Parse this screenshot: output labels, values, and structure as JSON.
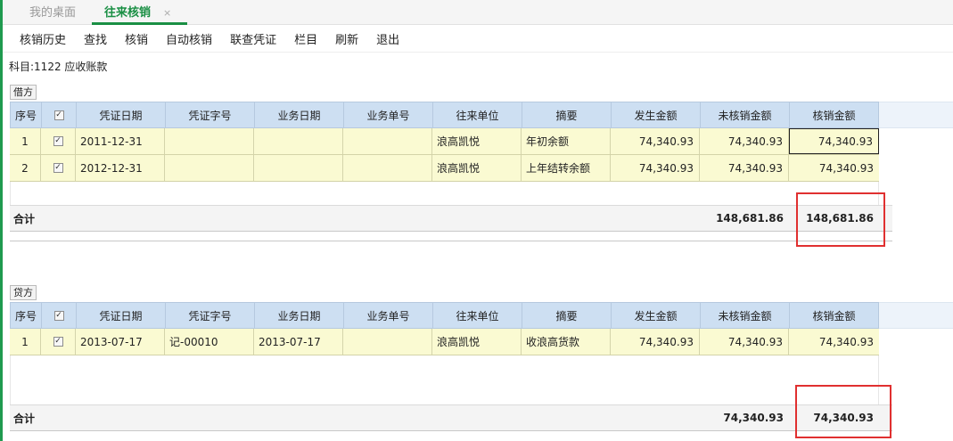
{
  "tabs": [
    {
      "label": "我的桌面"
    },
    {
      "label": "往来核销",
      "close": "×"
    }
  ],
  "toolbar": {
    "items": [
      "核销历史",
      "查找",
      "核销",
      "自动核销",
      "联查凭证",
      "栏目",
      "刷新",
      "退出"
    ]
  },
  "subject": "科目:1122 应收账款",
  "columns": [
    "序号",
    "凭证日期",
    "凭证字号",
    "业务日期",
    "业务单号",
    "往来单位",
    "摘要",
    "发生金额",
    "未核销金额",
    "核销金额"
  ],
  "debit": {
    "label": "借方",
    "rows": [
      {
        "no": "1",
        "voucher_date": "2011-12-31",
        "voucher_no": "",
        "biz_date": "",
        "biz_no": "",
        "partner": "浪高凯悦",
        "summary": "年初余额",
        "amount": "74,340.93",
        "unsettled": "74,340.93",
        "settle": "74,340.93"
      },
      {
        "no": "2",
        "voucher_date": "2012-12-31",
        "voucher_no": "",
        "biz_date": "",
        "biz_no": "",
        "partner": "浪高凯悦",
        "summary": "上年结转余额",
        "amount": "74,340.93",
        "unsettled": "74,340.93",
        "settle": "74,340.93"
      }
    ],
    "total_label": "合计",
    "total_unsettled": "148,681.86",
    "total_settle": "148,681.86"
  },
  "credit": {
    "label": "贷方",
    "rows": [
      {
        "no": "1",
        "voucher_date": "2013-07-17",
        "voucher_no": "记-00010",
        "biz_date": "2013-07-17",
        "biz_no": "",
        "partner": "浪高凯悦",
        "summary": "收浪高货款",
        "amount": "74,340.93",
        "unsettled": "74,340.93",
        "settle": "74,340.93"
      }
    ],
    "total_label": "合计",
    "total_unsettled": "74,340.93",
    "total_settle": "74,340.93"
  },
  "checkbox_mark": "✓",
  "colors": {
    "accent": "#1a8f44",
    "header": "#cddff2",
    "row": "#fafad2",
    "highlight": "#e03030"
  }
}
